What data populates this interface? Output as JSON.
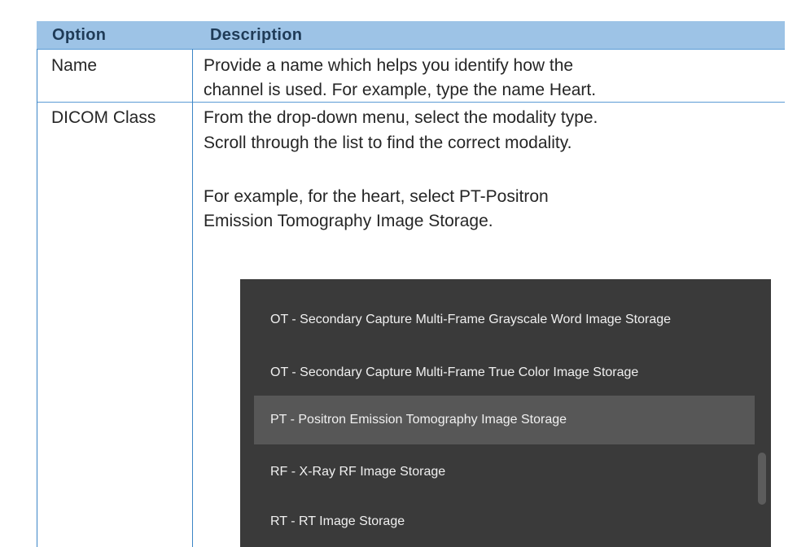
{
  "table": {
    "headers": {
      "option": "Option",
      "description": "Description"
    },
    "rows": [
      {
        "option": "Name",
        "description_lines": [
          "Provide a name which helps you identify how the",
          "channel is used. For example, type the name Heart."
        ]
      },
      {
        "option": "DICOM Class",
        "description_lines": [
          "From the drop-down menu, select the modality type.",
          "Scroll through the list to find the correct modality.",
          "For example, for the heart, select PT-Positron",
          "Emission Tomography Image Storage."
        ]
      }
    ]
  },
  "dropdown": {
    "items": [
      "OT - Secondary Capture Multi-Frame Grayscale Word Image Storage",
      "OT - Secondary Capture Multi-Frame True Color Image Storage",
      "PT - Positron Emission Tomography Image Storage",
      "RF - X-Ray RF Image Storage",
      "RT - RT Image Storage"
    ],
    "selected_index": 2
  },
  "colors": {
    "header_bg": "#9dc3e6",
    "border": "#5b9bd5",
    "dropdown_bg": "#3a3a3a",
    "dropdown_selected_bg": "#575757"
  }
}
